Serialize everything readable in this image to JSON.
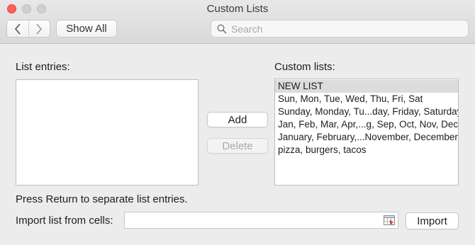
{
  "window": {
    "title": "Custom Lists"
  },
  "toolbar": {
    "back_icon": "chevron-left-icon",
    "forward_icon": "chevron-right-icon",
    "show_all_label": "Show All",
    "search_placeholder": "Search",
    "search_value": ""
  },
  "entries": {
    "label": "List entries:",
    "value": ""
  },
  "custom_lists": {
    "label": "Custom lists:",
    "items": [
      "NEW LIST",
      "Sun, Mon, Tue, Wed, Thu, Fri, Sat",
      "Sunday, Monday, Tu...day, Friday, Saturday",
      "Jan, Feb, Mar, Apr,...g, Sep, Oct, Nov, Dec",
      "January, February,...November, December",
      "pizza, burgers, tacos"
    ],
    "selected_index": 0
  },
  "buttons": {
    "add_label": "Add",
    "delete_label": "Delete",
    "import_label": "Import"
  },
  "hint_text": "Press Return to separate list entries.",
  "import": {
    "label": "Import list from cells:",
    "value": "",
    "range_icon": "range-select-icon"
  },
  "colors": {
    "close_button": "#fe5f57",
    "selected_row": "#dcdcdc",
    "window_bg": "#ececec"
  }
}
